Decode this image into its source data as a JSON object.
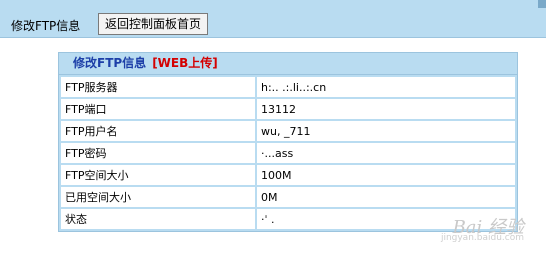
{
  "topbar": {
    "title": "修改FTP信息",
    "back_button": "返回控制面板首页"
  },
  "panel": {
    "title": "修改FTP信息",
    "tag": "[WEB上传]"
  },
  "rows": [
    {
      "label": "FTP服务器",
      "value": "h:.. .:.li..:.cn"
    },
    {
      "label": "FTP端口",
      "value": "13112"
    },
    {
      "label": "FTP用户名",
      "value": "wu, _711"
    },
    {
      "label": "FTP密码",
      "value": "·...ass"
    },
    {
      "label": "FTP空间大小",
      "value": "100M"
    },
    {
      "label": "已用空间大小",
      "value": "0M"
    },
    {
      "label": "状态",
      "value": "·ˈ ."
    }
  ],
  "watermark": {
    "text": "Bai 经验",
    "sub": "jingyan.baidu.com"
  }
}
